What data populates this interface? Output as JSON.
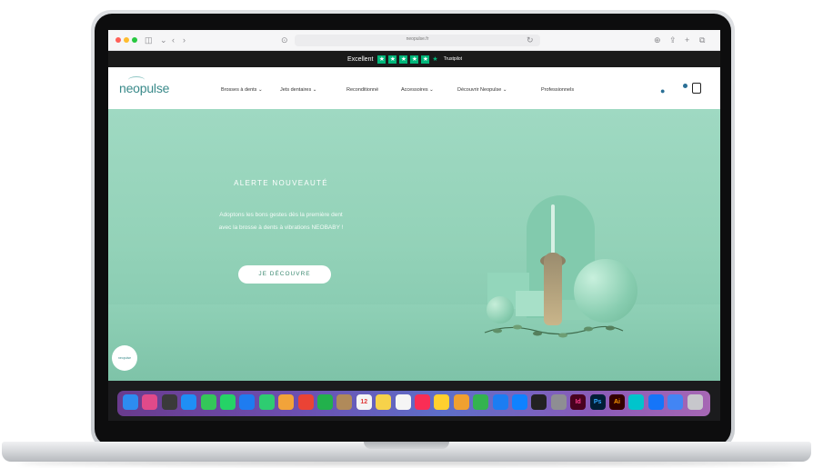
{
  "browser": {
    "url": "neopulse.fr"
  },
  "trust": {
    "label": "Excellent",
    "stars": 5,
    "brand": "Trustpilot"
  },
  "nav": {
    "logo": "neopulse",
    "items": [
      "Brosses à dents",
      "Jets dentaires",
      "Reconditionné",
      "Accessoires",
      "Découvrir Neopulse",
      "Professionnels"
    ]
  },
  "hero": {
    "title": "ALERTE NOUVEAUTÉ",
    "line1": "Adoptons les bons gestes dès la première dent",
    "line2": "avec la brosse à dents à vibrations NEOBABY !",
    "cta": "JE DÉCOUVRE"
  },
  "badge": {
    "text": "neopulse"
  },
  "dock": {
    "icons": [
      {
        "name": "finder-icon",
        "color": "#2d8cf0"
      },
      {
        "name": "launchpad-icon",
        "color": "#e04a8a"
      },
      {
        "name": "mission-control-icon",
        "color": "#3a3a3a"
      },
      {
        "name": "safari-icon",
        "color": "#1f8ff5"
      },
      {
        "name": "messages-icon",
        "color": "#34c759"
      },
      {
        "name": "whatsapp-icon",
        "color": "#25d366"
      },
      {
        "name": "mail-icon",
        "color": "#1e7cf0"
      },
      {
        "name": "facetime-icon",
        "color": "#2ecc71"
      },
      {
        "name": "photos-icon",
        "color": "#f2a33a"
      },
      {
        "name": "chrome-icon",
        "color": "#ea4335"
      },
      {
        "name": "facetime-video-icon",
        "color": "#22b14c"
      },
      {
        "name": "contacts-icon",
        "color": "#b08a5a"
      },
      {
        "name": "calendar-icon",
        "color": "#f4f4f4"
      },
      {
        "name": "notes-icon",
        "color": "#f7d24a"
      },
      {
        "name": "reminders-icon",
        "color": "#f5f5f5"
      },
      {
        "name": "music-icon",
        "color": "#fa2d55"
      },
      {
        "name": "miro-icon",
        "color": "#ffd02f"
      },
      {
        "name": "pencil-icon",
        "color": "#f0a030"
      },
      {
        "name": "numbers-icon",
        "color": "#33b34f"
      },
      {
        "name": "keynote-icon",
        "color": "#1c7df2"
      },
      {
        "name": "app-store-icon",
        "color": "#0f82ff"
      },
      {
        "name": "terminal-icon",
        "color": "#222222"
      },
      {
        "name": "system-preferences-icon",
        "color": "#8e8e93"
      },
      {
        "name": "indesign-icon",
        "color": "#49021f"
      },
      {
        "name": "photoshop-icon",
        "color": "#001e36"
      },
      {
        "name": "illustrator-icon",
        "color": "#330000"
      },
      {
        "name": "canva-icon",
        "color": "#00c4cc"
      },
      {
        "name": "xcode-icon",
        "color": "#1575f9"
      },
      {
        "name": "chrome-2-icon",
        "color": "#4285f4"
      },
      {
        "name": "trash-icon",
        "color": "#c7c7cc"
      }
    ],
    "labels": {
      "calendar": "12",
      "indesign": "Id",
      "photoshop": "Ps",
      "illustrator": "Ai"
    }
  }
}
